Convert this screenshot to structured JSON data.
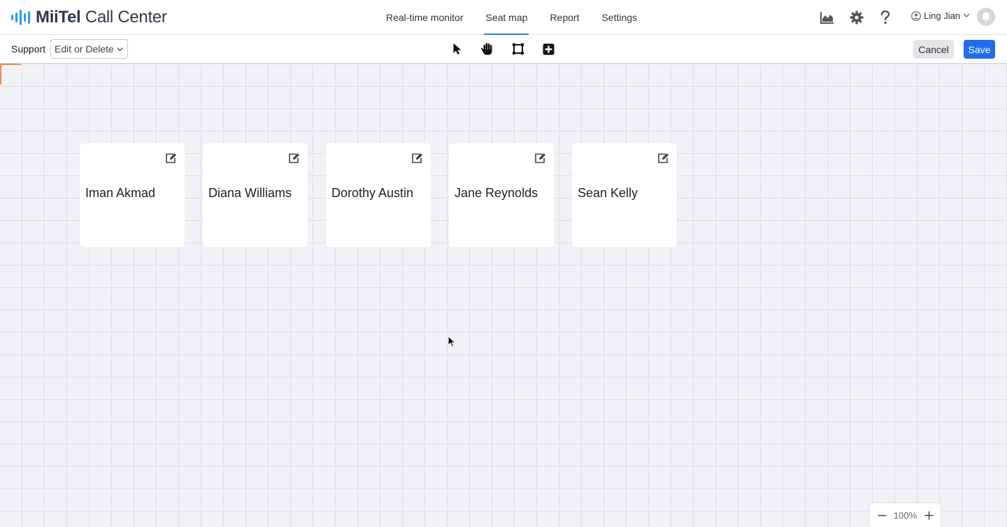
{
  "app": {
    "brand": "MiiTel",
    "product": "Call Center"
  },
  "nav": {
    "tabs": [
      {
        "label": "Real-time monitor",
        "active": false
      },
      {
        "label": "Seat map",
        "active": true
      },
      {
        "label": "Report",
        "active": false
      },
      {
        "label": "Settings",
        "active": false
      }
    ]
  },
  "header": {
    "icons": [
      "chart-icon",
      "gear-icon",
      "help-icon"
    ],
    "user_name": "Ling Jian",
    "notification_icon": "bell-icon"
  },
  "toolbar": {
    "group_label": "Support",
    "mode_select": "Edit or Delete",
    "tools": [
      "select-pointer-tool",
      "pan-hand-tool",
      "frame-tool",
      "add-seat-tool"
    ],
    "cancel_label": "Cancel",
    "save_label": "Save"
  },
  "seats": [
    {
      "name": "Iman Akmad"
    },
    {
      "name": "Diana Williams"
    },
    {
      "name": "Dorothy Austin"
    },
    {
      "name": "Jane Reynolds"
    },
    {
      "name": "Sean Kelly"
    }
  ],
  "zoom": {
    "level": "100%"
  },
  "colors": {
    "accent": "#2f7fd7",
    "save": "#1f6ee8",
    "logo": "#2b9fd9",
    "origin": "#f08a4b"
  }
}
